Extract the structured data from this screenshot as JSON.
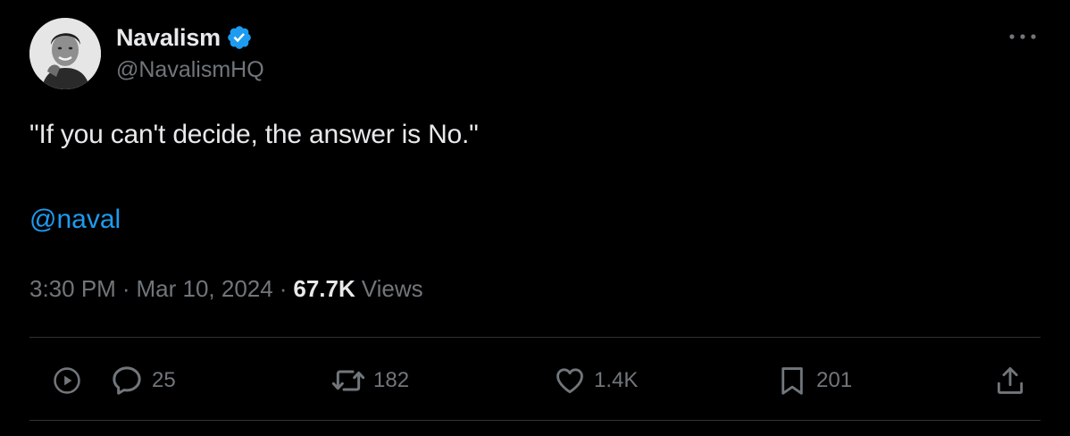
{
  "author": {
    "display_name": "Navalism",
    "handle": "@NavalismHQ",
    "verified": true
  },
  "tweet": {
    "text": "\"If you can't decide, the answer is No.\"",
    "mention": "@naval"
  },
  "meta": {
    "time": "3:30 PM",
    "separator": "·",
    "date": "Mar 10, 2024",
    "views_count": "67.7K",
    "views_label": "Views"
  },
  "actions": {
    "replies": "25",
    "reposts": "182",
    "likes": "1.4K",
    "bookmarks": "201"
  },
  "colors": {
    "background": "#000000",
    "text_primary": "#e7e9ea",
    "text_secondary": "#71767b",
    "accent": "#1d9bf0",
    "divider": "#2f3336"
  },
  "icons": {
    "avatar": "author-avatar",
    "verified": "verified-badge-icon",
    "more": "more-options-icon",
    "play": "play-circle-icon",
    "reply": "reply-bubble-icon",
    "repost": "repost-arrows-icon",
    "like": "heart-icon",
    "bookmark": "bookmark-icon",
    "share": "share-upload-icon"
  }
}
